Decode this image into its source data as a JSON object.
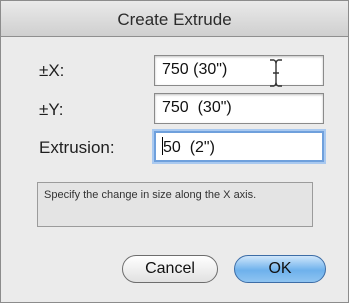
{
  "dialog": {
    "title": "Create Extrude"
  },
  "fields": {
    "x": {
      "label": "±X:",
      "value": "750 (30\")"
    },
    "y": {
      "label": "±Y:",
      "value": "750  (30\")"
    },
    "extrusion": {
      "label": "Extrusion:",
      "value": "50  (2\")"
    }
  },
  "help_text": "Specify the change in size along the X axis.",
  "buttons": {
    "cancel": "Cancel",
    "ok": "OK"
  },
  "colors": {
    "focus_ring": "#6fa0dc",
    "ok_button": "#6eb1ec"
  },
  "cursor_icon": "text-ibeam-cursor-icon"
}
